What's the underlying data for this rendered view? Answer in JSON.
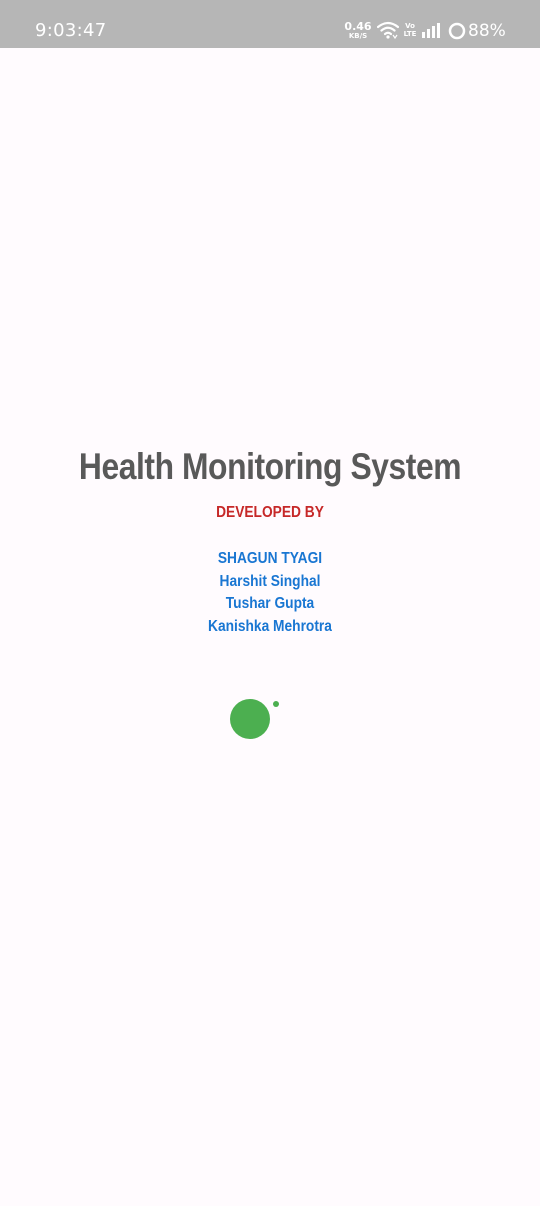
{
  "status_bar": {
    "time": "9:03:47",
    "net_speed_value": "0.46",
    "net_speed_unit": "KB/S",
    "volte_top": "Vo",
    "volte_bottom": "LTE",
    "battery": "88%",
    "icons": [
      "wifi-icon",
      "volte-icon",
      "signal-icon",
      "battery-ring-icon"
    ]
  },
  "splash": {
    "title": "Health Monitoring System",
    "developed_by": "DEVELOPED BY",
    "developers": [
      "SHAGUN TYAGI",
      "Harshit Singhal",
      "Tushar Gupta",
      "Kanishka Mehrotra"
    ]
  },
  "colors": {
    "title": "#595959",
    "developed_by": "#c62828",
    "developers": "#1976d2",
    "loader": "#4caf50",
    "status_bar": "#b6b6b6",
    "background": "#fffbfe"
  }
}
